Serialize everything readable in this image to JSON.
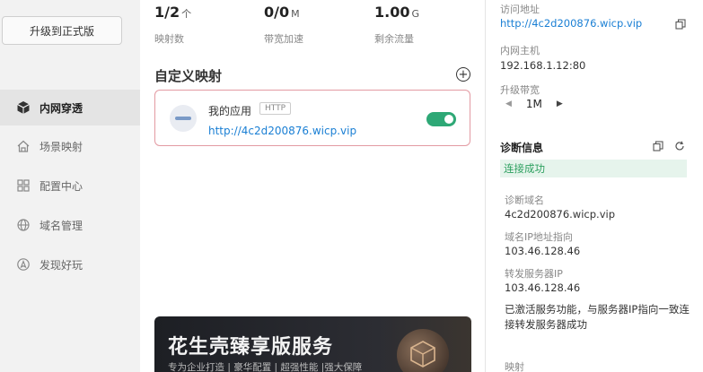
{
  "sidebar": {
    "upgrade_label": "升级到正式版",
    "items": [
      {
        "label": "内网穿透",
        "icon": "cube-icon"
      },
      {
        "label": "场景映射",
        "icon": "home-icon"
      },
      {
        "label": "配置中心",
        "icon": "grid-icon"
      },
      {
        "label": "域名管理",
        "icon": "globe-icon"
      },
      {
        "label": "发现好玩",
        "icon": "compass-icon"
      }
    ]
  },
  "stats": [
    {
      "value": "1/2",
      "unit": "个",
      "label": "映射数"
    },
    {
      "value": "0/0",
      "unit": "M",
      "label": "带宽加速"
    },
    {
      "value": "1.00",
      "unit": "G",
      "label": "剩余流量"
    }
  ],
  "mapping": {
    "section_title": "自定义映射",
    "add_icon": "plus-circle-icon",
    "card": {
      "name": "我的应用",
      "protocol": "HTTP",
      "url": "http://4c2d200876.wicp.vip",
      "enabled": true,
      "toggle_color": "#2ea876"
    }
  },
  "promo": {
    "title": "花生壳臻享版服务",
    "subtitle": "专为企业打造 | 豪华配置 | 超强性能 |强大保障"
  },
  "detail": {
    "access_label": "访问地址",
    "access_url": "http://4c2d200876.wicp.vip",
    "host_label": "内网主机",
    "host_value": "192.168.1.12:80",
    "bandwidth_label": "升级带宽",
    "bandwidth_value": "1M",
    "diag_title": "诊断信息",
    "status_text": "连接成功",
    "status_color": "#2ea060",
    "domain_label": "诊断域名",
    "domain_value": "4c2d200876.wicp.vip",
    "ip_label": "域名IP地址指向",
    "ip_value": "103.46.128.46",
    "server_label": "转发服务器IP",
    "server_value": "103.46.128.46",
    "note": "已激活服务功能，与服务器IP指向一致连接转发服务器成功",
    "mapping_label": "映射"
  }
}
